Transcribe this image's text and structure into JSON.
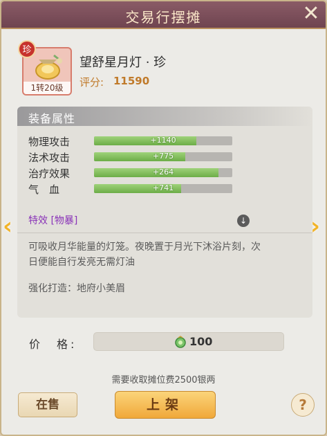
{
  "window": {
    "title": "交易行摆摊",
    "close_glyph": "✕"
  },
  "item": {
    "name": "望舒星月灯 · 珍",
    "rarity_badge": "珍",
    "level_tag": "1转20级",
    "icon": "lantern-icon",
    "score_label": "评分:",
    "score_value": "11590"
  },
  "attributes": {
    "header": "装备属性",
    "stats": [
      {
        "label": "物理攻击",
        "value": "+1140",
        "fill": 0.74
      },
      {
        "label": "法术攻击",
        "value": "+775",
        "fill": 0.66
      },
      {
        "label": "治疗效果",
        "value": "+264",
        "fill": 0.9
      },
      {
        "label": "气　血",
        "value": "+741",
        "fill": 0.63
      }
    ],
    "effect_label": "特效 [物暴]",
    "description": "可吸收月华能量的灯笼。夜晚置于月光下沐浴片刻，次日便能自行发亮无需灯油",
    "forge": "强化打造：地府小美眉"
  },
  "price": {
    "label": "价　格:",
    "value": "100",
    "currency_icon": "jade-coin-icon"
  },
  "fee_note": "需要收取摊位费2500银两",
  "buttons": {
    "on_sale": "在售",
    "shelve": "上架",
    "help": "?"
  },
  "nav": {
    "left": "‹",
    "right": "›"
  },
  "colors": {
    "title_bar": "#7a4d59",
    "accent_gold": "#f0a83a",
    "score": "#c07a2a",
    "effect": "#8a34b8",
    "bar_green": "#6cad47"
  }
}
